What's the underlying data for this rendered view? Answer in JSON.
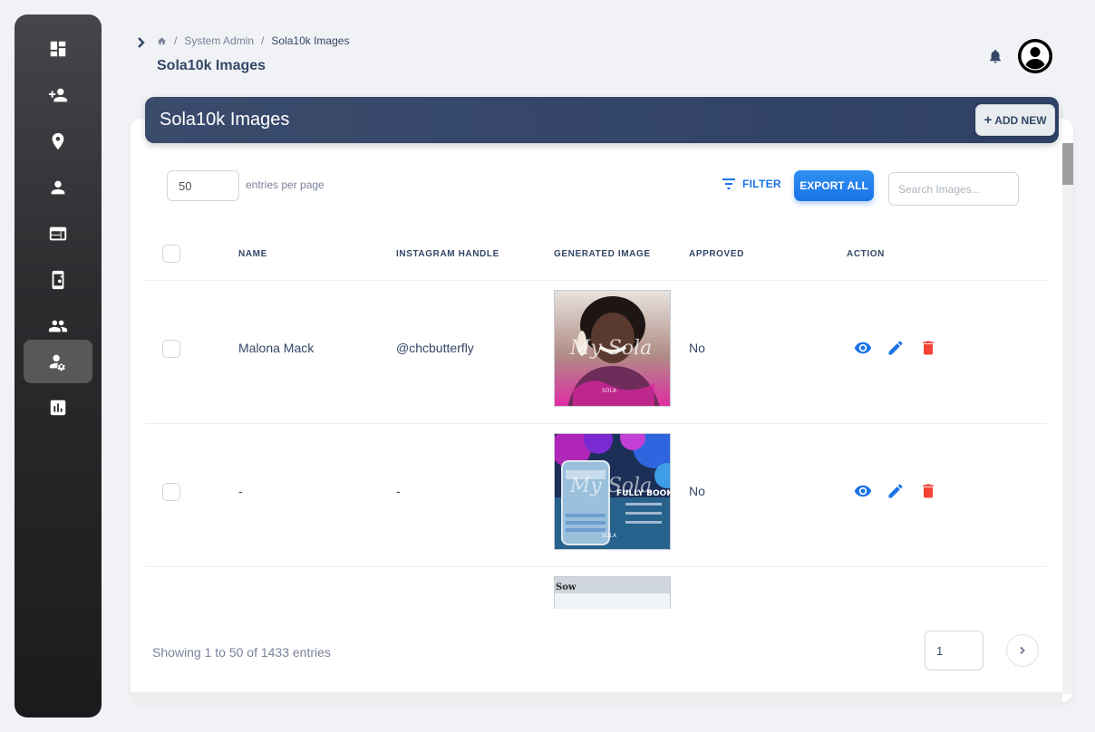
{
  "breadcrumb": {
    "home_icon": "home-icon",
    "parent": "System Admin",
    "current": "Sola10k Images",
    "separator": "/"
  },
  "page_title": "Sola10k Images",
  "card": {
    "title": "Sola10k Images",
    "add_new_label": "ADD NEW",
    "add_new_plus": "+"
  },
  "toolbar": {
    "entries_value": "50",
    "entries_label": "entries per page",
    "filter_label": "FILTER",
    "export_label": "EXPORT ALL",
    "search_placeholder": "Search Images..."
  },
  "table": {
    "columns": [
      "NAME",
      "INSTAGRAM HANDLE",
      "GENERATED IMAGE",
      "APPROVED",
      "ACTION"
    ],
    "rows": [
      {
        "name": "Malona Mack",
        "instagram": "@chcbutterfly",
        "approved": "No"
      },
      {
        "name": "-",
        "instagram": "-",
        "approved": "No"
      }
    ]
  },
  "generated_images": [
    {
      "overlay_text": "My Sola",
      "brand": "SOLA"
    },
    {
      "overlay_text": "My Sola",
      "heading": "FULLY BOOKED",
      "brand": "SOLA"
    },
    {
      "overlay_text": "Sow"
    }
  ],
  "footer": {
    "showing": "Showing 1 to 50 of 1433 entries",
    "page_value": "1"
  },
  "colors": {
    "primary": "#1A73E8",
    "danger": "#F44335",
    "header_bg": "#344767",
    "text": "#344767"
  },
  "sidebar": {
    "items": [
      {
        "icon": "dashboard-icon"
      },
      {
        "icon": "person-add-icon"
      },
      {
        "icon": "location-pin-icon"
      },
      {
        "icon": "person-icon"
      },
      {
        "icon": "web-icon"
      },
      {
        "icon": "app-settings-icon"
      },
      {
        "icon": "group-icon"
      },
      {
        "icon": "manage-accounts-icon",
        "active": true
      },
      {
        "icon": "analytics-icon"
      }
    ]
  }
}
